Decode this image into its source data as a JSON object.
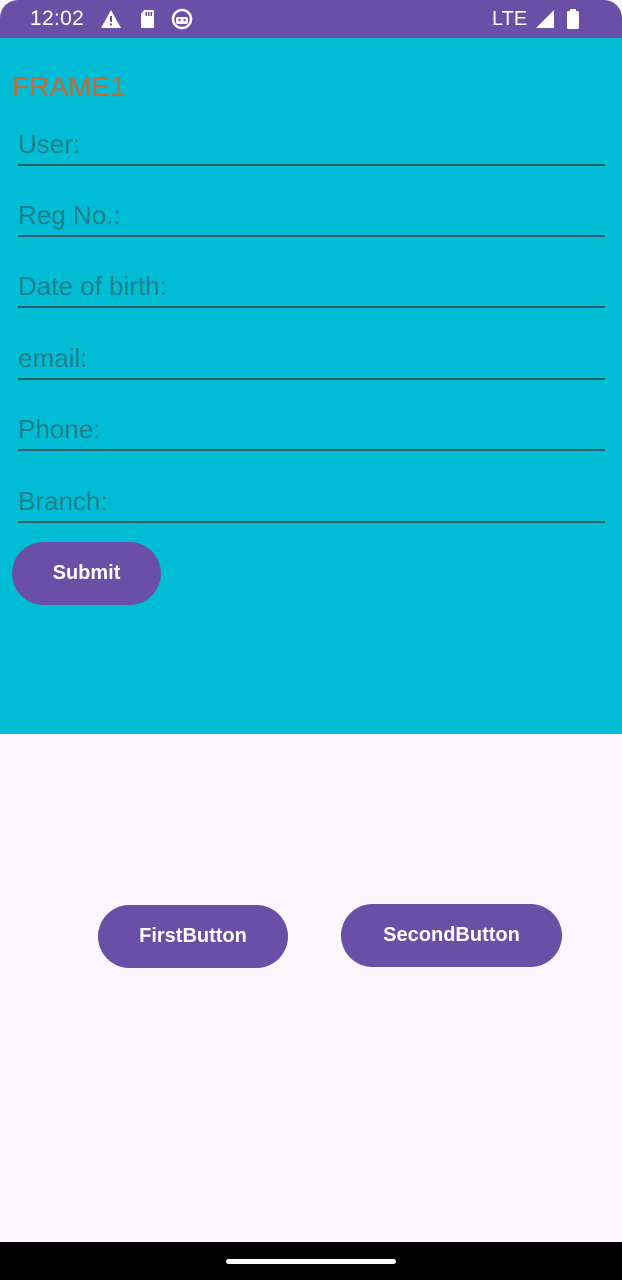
{
  "status_bar": {
    "time": "12:02",
    "network": "LTE",
    "icons": [
      "warning-icon",
      "sd-card-icon",
      "android-icon",
      "signal-icon",
      "battery-icon"
    ]
  },
  "frame1": {
    "title": "FRAME1",
    "fields": [
      {
        "placeholder": "User:"
      },
      {
        "placeholder": "Reg No.:"
      },
      {
        "placeholder": "Date of birth:"
      },
      {
        "placeholder": "email:"
      },
      {
        "placeholder": "Phone:"
      },
      {
        "placeholder": "Branch:"
      }
    ],
    "submit_label": "Submit"
  },
  "buttons": {
    "first_label": "FirstButton",
    "second_label": "SecondButton"
  },
  "colors": {
    "accent": "#6a4fa6",
    "frame_background": "#00bcd4",
    "title": "#c8693a",
    "page_background": "#fcf6fd"
  }
}
